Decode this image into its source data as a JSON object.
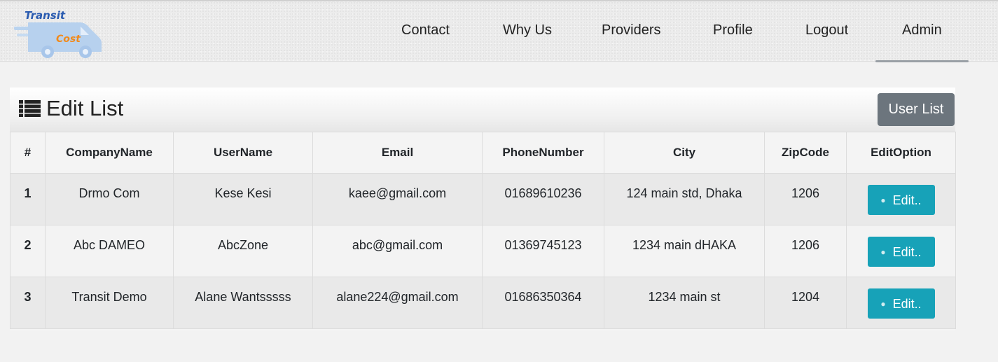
{
  "brand": {
    "line1": "Transit",
    "line2": "Cost"
  },
  "nav": {
    "items": [
      {
        "label": "Contact"
      },
      {
        "label": "Why Us"
      },
      {
        "label": "Providers"
      },
      {
        "label": "Profile"
      },
      {
        "label": "Logout"
      },
      {
        "label": "Admin",
        "active": true
      }
    ]
  },
  "card": {
    "title": "Edit List",
    "user_list_label": "User List"
  },
  "table": {
    "headers": [
      "#",
      "CompanyName",
      "UserName",
      "Email",
      "PhoneNumber",
      "City",
      "ZipCode",
      "EditOption"
    ],
    "rows": [
      {
        "index": "1",
        "company": "Drmo Com",
        "user": "Kese Kesi",
        "email": "kaee@gmail.com",
        "phone": "01689610236",
        "city": "124 main std, Dhaka",
        "zip": "1206",
        "edit_label": "Edit.."
      },
      {
        "index": "2",
        "company": "Abc DAMEO",
        "user": "AbcZone",
        "email": "abc@gmail.com",
        "phone": "01369745123",
        "city": "1234 main dHAKA",
        "zip": "1206",
        "edit_label": "Edit.."
      },
      {
        "index": "3",
        "company": "Transit Demo",
        "user": "Alane Wantsssss",
        "email": "alane224@gmail.com",
        "phone": "01686350364",
        "city": "1234 main st",
        "zip": "1204",
        "edit_label": "Edit.."
      }
    ]
  },
  "colors": {
    "edit_button": "#17a2b8",
    "user_list_button": "#6c757d"
  }
}
